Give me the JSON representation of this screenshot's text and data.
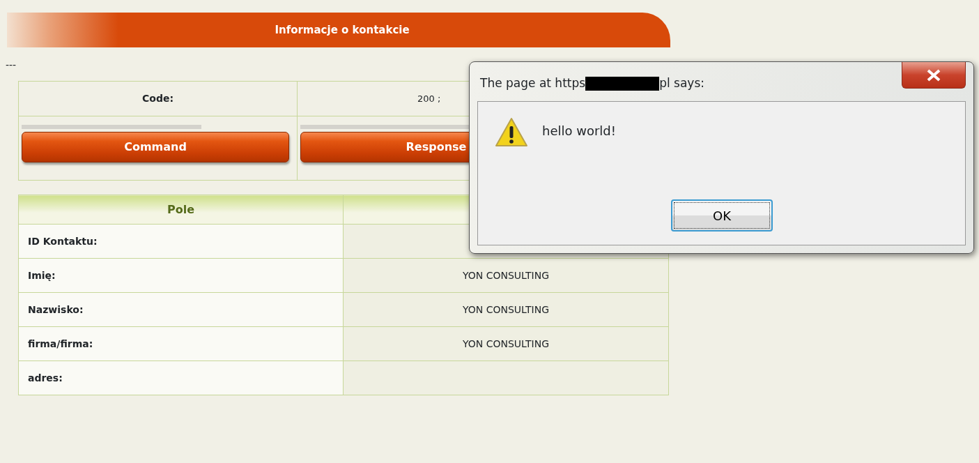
{
  "header": {
    "title": "Informacje o kontakcie"
  },
  "separator_text": "---",
  "status_table": {
    "label": "Code:",
    "value": "200 ;"
  },
  "buttons": [
    {
      "label": "Command"
    },
    {
      "label": "Response"
    }
  ],
  "fields_table": {
    "columns": [
      "Pole"
    ],
    "rows": [
      {
        "field": "ID Kontaktu:"
      },
      {
        "field": "Imię:",
        "value": "YON CONSULTING"
      },
      {
        "field": "Nazwisko:",
        "value": "YON CONSULTING"
      },
      {
        "field": "firma/firma:",
        "value": "YON CONSULTING"
      },
      {
        "field": "adres:"
      }
    ]
  },
  "dialog": {
    "title_start": "The page at https",
    "redacted": true,
    "title_end": "pl says:",
    "message": "hello world!",
    "buttons": [
      {
        "label": "OK",
        "selected": true
      }
    ]
  }
}
